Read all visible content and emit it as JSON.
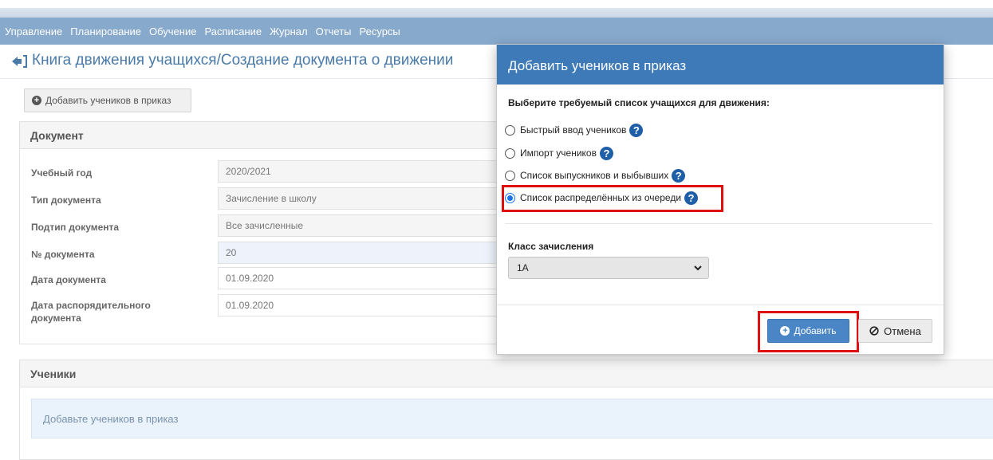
{
  "nav": {
    "items": [
      "Управление",
      "Планирование",
      "Обучение",
      "Расписание",
      "Журнал",
      "Отчеты",
      "Ресурсы"
    ]
  },
  "header": {
    "title": "Книга движения учащихся/Создание документа о движении"
  },
  "toolbar": {
    "add_students_label": "Добавить учеников в приказ"
  },
  "document": {
    "title": "Документ",
    "fields": [
      {
        "label": "Учебный год",
        "value": "2020/2021"
      },
      {
        "label": "Тип документа",
        "value": "Зачисление в школу"
      },
      {
        "label": "Подтип документа",
        "value": "Все зачисленные"
      },
      {
        "label": "№ документа",
        "value": "20"
      },
      {
        "label": "Дата документа",
        "value": "01.09.2020"
      },
      {
        "label": "Дата распорядительного документа",
        "value": "01.09.2020"
      }
    ]
  },
  "students": {
    "title": "Ученики",
    "empty_message": "Добавьте учеников в приказ"
  },
  "modal": {
    "title": "Добавить учеников в приказ",
    "prompt": "Выберите требуемый список учащихся для движения:",
    "options": [
      {
        "label": "Быстрый ввод учеников",
        "selected": false
      },
      {
        "label": "Импорт учеников",
        "selected": false
      },
      {
        "label": "Список выпускников и выбывших",
        "selected": false
      },
      {
        "label": "Список распределённых из очереди",
        "selected": true
      }
    ],
    "class_label": "Класс зачисления",
    "class_value": "1А",
    "add_button": "Добавить",
    "cancel_button": "Отмена"
  },
  "colors": {
    "navbar": "#87a9cc",
    "modal_header": "#3d7ab7",
    "primary_button": "#4a86c6",
    "highlight": "#e01010"
  },
  "icons": [
    "back-arrow-icon",
    "plus-circle-icon",
    "help-icon",
    "chevron-down-icon",
    "ban-icon"
  ]
}
